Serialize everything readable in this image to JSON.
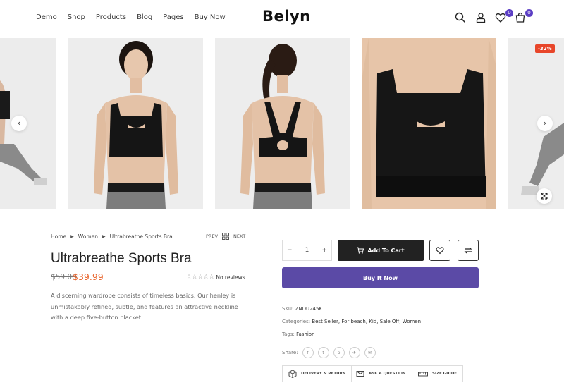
{
  "header": {
    "nav": [
      "Demo",
      "Shop",
      "Products",
      "Blog",
      "Pages",
      "Buy Now"
    ],
    "logo": "Belyn",
    "wishlist_count": "0",
    "cart_count": "0"
  },
  "gallery": {
    "sale_badge": "-32%"
  },
  "product": {
    "breadcrumb": [
      "Home",
      "Women",
      "Ultrabreathe Sports Bra"
    ],
    "prev_label": "PREV",
    "next_label": "NEXT",
    "title": "Ultrabreathe Sports Bra",
    "price_old": "$59.00",
    "price_new": "$39.99",
    "rating": 0,
    "reviews_label": "No reviews",
    "description": "A discerning wardrobe consists of timeless basics. Our henley is unmistakably refined, subtle, and features an attractive neckline with a deep five-button placket."
  },
  "purchase": {
    "quantity": "1",
    "add_to_cart": "Add To Cart",
    "buy_now": "Buy It Now"
  },
  "meta": {
    "sku_label": "SKU:",
    "sku": "ZNDU245K",
    "categories_label": "Categories:",
    "categories": "Best Seller, For beach, Kid, Sale Off, Women",
    "tags_label": "Tags:",
    "tags": "Fashion",
    "share_label": "Share:"
  },
  "info_buttons": {
    "delivery": "DELIVERY & RETURN",
    "question": "ASK A QUESTION",
    "size_guide": "SIZE GUIDE"
  },
  "colors": {
    "accent": "#5b4aa6",
    "badge": "#5b3ec4",
    "sale": "#e8462a",
    "price": "#e8642c"
  }
}
